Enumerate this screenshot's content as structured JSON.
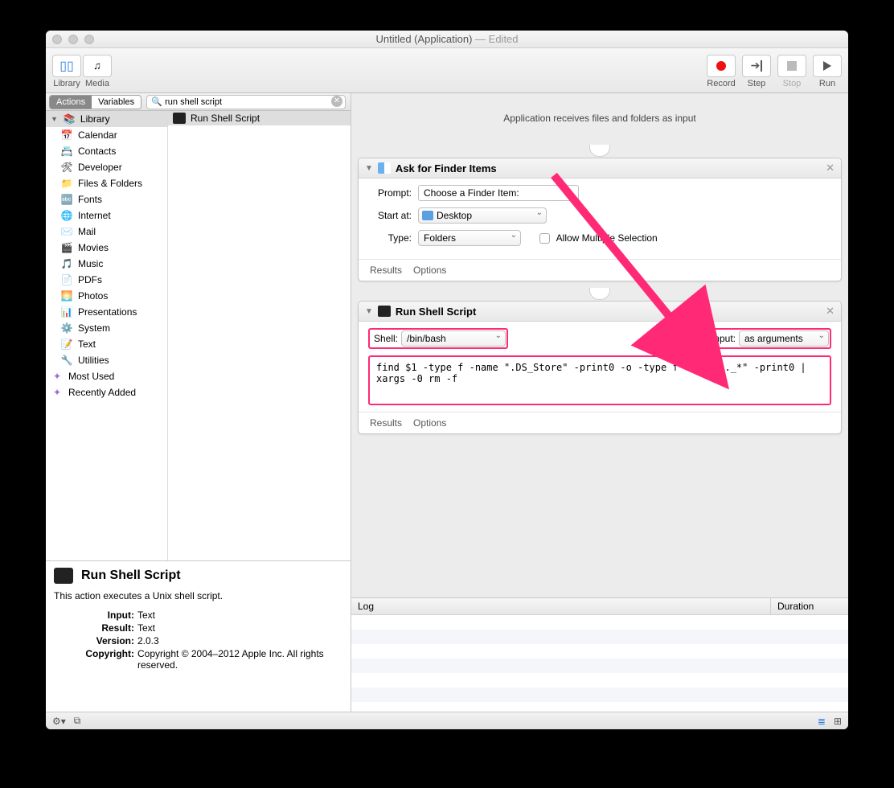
{
  "window": {
    "title": "Untitled (Application)",
    "edited": "— Edited"
  },
  "toolbar": {
    "library": "Library",
    "media": "Media",
    "record": "Record",
    "step": "Step",
    "stop": "Stop",
    "run": "Run"
  },
  "tabs": {
    "actions": "Actions",
    "variables": "Variables"
  },
  "search": {
    "placeholder": "",
    "value": "run shell script"
  },
  "library": {
    "header": "Library",
    "items": [
      {
        "icon": "📅",
        "label": "Calendar"
      },
      {
        "icon": "📇",
        "label": "Contacts"
      },
      {
        "icon": "🛠",
        "label": "Developer"
      },
      {
        "icon": "📁",
        "label": "Files & Folders"
      },
      {
        "icon": "🔤",
        "label": "Fonts"
      },
      {
        "icon": "🌐",
        "label": "Internet"
      },
      {
        "icon": "✉️",
        "label": "Mail"
      },
      {
        "icon": "🎬",
        "label": "Movies"
      },
      {
        "icon": "🎵",
        "label": "Music"
      },
      {
        "icon": "📄",
        "label": "PDFs"
      },
      {
        "icon": "🌅",
        "label": "Photos"
      },
      {
        "icon": "📊",
        "label": "Presentations"
      },
      {
        "icon": "⚙️",
        "label": "System"
      },
      {
        "icon": "📝",
        "label": "Text"
      },
      {
        "icon": "🔧",
        "label": "Utilities"
      }
    ],
    "smart": [
      {
        "label": "Most Used"
      },
      {
        "label": "Recently Added"
      }
    ]
  },
  "result": {
    "label": "Run Shell Script"
  },
  "workflow_desc": "Application receives files and folders as input",
  "action1": {
    "title": "Ask for Finder Items",
    "prompt_label": "Prompt:",
    "prompt_value": "Choose a Finder Item:",
    "start_label": "Start at:",
    "start_value": "Desktop",
    "type_label": "Type:",
    "type_value": "Folders",
    "allow_label": "Allow Multiple Selection",
    "results": "Results",
    "options": "Options"
  },
  "action2": {
    "title": "Run Shell Script",
    "shell_label": "Shell:",
    "shell_value": "/bin/bash",
    "pass_label": "Pass input:",
    "pass_value": "as arguments",
    "code": "find $1 -type f -name \".DS_Store\" -print0 -o -type f -name \"._*\" -print0 | xargs -0 rm -f",
    "results": "Results",
    "options": "Options"
  },
  "info": {
    "title": "Run Shell Script",
    "desc": "This action executes a Unix shell script.",
    "rows": [
      {
        "k": "Input:",
        "v": "Text"
      },
      {
        "k": "Result:",
        "v": "Text"
      },
      {
        "k": "Version:",
        "v": "2.0.3"
      },
      {
        "k": "Copyright:",
        "v": "Copyright © 2004–2012 Apple Inc.  All rights reserved."
      }
    ]
  },
  "log": {
    "col1": "Log",
    "col2": "Duration"
  }
}
